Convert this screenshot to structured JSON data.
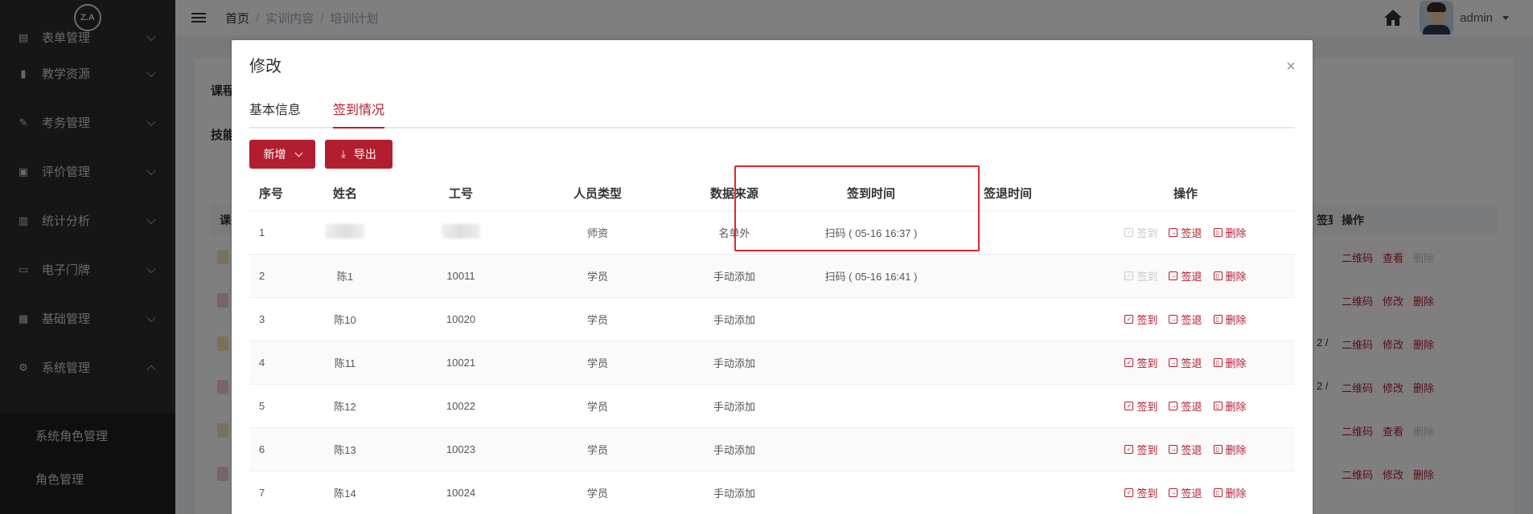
{
  "sidebar": {
    "logo": "Z.A",
    "items": [
      {
        "label": "表单管理",
        "icon": "form-icon"
      },
      {
        "label": "教学资源",
        "icon": "book-icon"
      },
      {
        "label": "考务管理",
        "icon": "edit-icon"
      },
      {
        "label": "评价管理",
        "icon": "evaluate-icon"
      },
      {
        "label": "统计分析",
        "icon": "bar-chart-icon"
      },
      {
        "label": "电子门牌",
        "icon": "monitor-icon"
      },
      {
        "label": "基础管理",
        "icon": "grid-icon"
      },
      {
        "label": "系统管理",
        "icon": "gear-icon"
      }
    ],
    "subitems": [
      {
        "label": "系统角色管理"
      },
      {
        "label": "角色管理"
      }
    ]
  },
  "topbar": {
    "breadcrumb": [
      "首页",
      "实训内容",
      "培训计划"
    ],
    "user": "admin"
  },
  "background": {
    "label1": "课程",
    "label2": "技能",
    "col_head_left": "课",
    "col_head_sign": "签到",
    "ops_head": "操作",
    "rows": [
      {
        "qr": "二维码",
        "mid": "查看",
        "del": "删除",
        "mid_icon": "eye-icon",
        "del_disabled": true
      },
      {
        "qr": "二维码",
        "mid": "修改",
        "del": "删除",
        "mid_icon": "pencil-icon",
        "del_disabled": false
      },
      {
        "qr": "二维码",
        "mid": "修改",
        "del": "删除",
        "mid_icon": "pencil-icon",
        "del_disabled": false,
        "frac": "2 /"
      },
      {
        "qr": "二维码",
        "mid": "修改",
        "del": "删除",
        "mid_icon": "pencil-icon",
        "del_disabled": false,
        "frac": "2 /"
      },
      {
        "qr": "二维码",
        "mid": "查看",
        "del": "删除",
        "mid_icon": "eye-icon",
        "del_disabled": true
      },
      {
        "qr": "二维码",
        "mid": "修改",
        "del": "删除",
        "mid_icon": "pencil-icon",
        "del_disabled": false
      }
    ]
  },
  "dialog": {
    "title": "修改",
    "close": "×",
    "tabs": [
      {
        "label": "基本信息",
        "active": false
      },
      {
        "label": "签到情况",
        "active": true
      }
    ],
    "buttons": {
      "add": "新增",
      "export": "导出"
    },
    "table": {
      "headers": [
        "序号",
        "姓名",
        "工号",
        "人员类型",
        "数据来源",
        "签到时间",
        "签退时间",
        "操作"
      ],
      "rows": [
        {
          "no": "1",
          "name": "",
          "id": "",
          "type": "师资",
          "source": "名单外",
          "signin": "扫码 ( 05-16 16:37 )",
          "signout": "",
          "signin_enabled": false,
          "blurred": true
        },
        {
          "no": "2",
          "name": "陈1",
          "id": "10011",
          "type": "学员",
          "source": "手动添加",
          "signin": "扫码 ( 05-16 16:41 )",
          "signout": "",
          "signin_enabled": false,
          "blurred": false
        },
        {
          "no": "3",
          "name": "陈10",
          "id": "10020",
          "type": "学员",
          "source": "手动添加",
          "signin": "",
          "signout": "",
          "signin_enabled": true,
          "blurred": false
        },
        {
          "no": "4",
          "name": "陈11",
          "id": "10021",
          "type": "学员",
          "source": "手动添加",
          "signin": "",
          "signout": "",
          "signin_enabled": true,
          "blurred": false
        },
        {
          "no": "5",
          "name": "陈12",
          "id": "10022",
          "type": "学员",
          "source": "手动添加",
          "signin": "",
          "signout": "",
          "signin_enabled": true,
          "blurred": false
        },
        {
          "no": "6",
          "name": "陈13",
          "id": "10023",
          "type": "学员",
          "source": "手动添加",
          "signin": "",
          "signout": "",
          "signin_enabled": true,
          "blurred": false
        },
        {
          "no": "7",
          "name": "陈14",
          "id": "10024",
          "type": "学员",
          "source": "手动添加",
          "signin": "",
          "signout": "",
          "signin_enabled": true,
          "blurred": false
        }
      ],
      "ops": {
        "signin": "签到",
        "signout": "签退",
        "delete": "删除"
      }
    }
  },
  "colors": {
    "accent": "#b31d30",
    "sidebar_bg": "#2d2d2d",
    "highlight_box": "#e0242b"
  }
}
